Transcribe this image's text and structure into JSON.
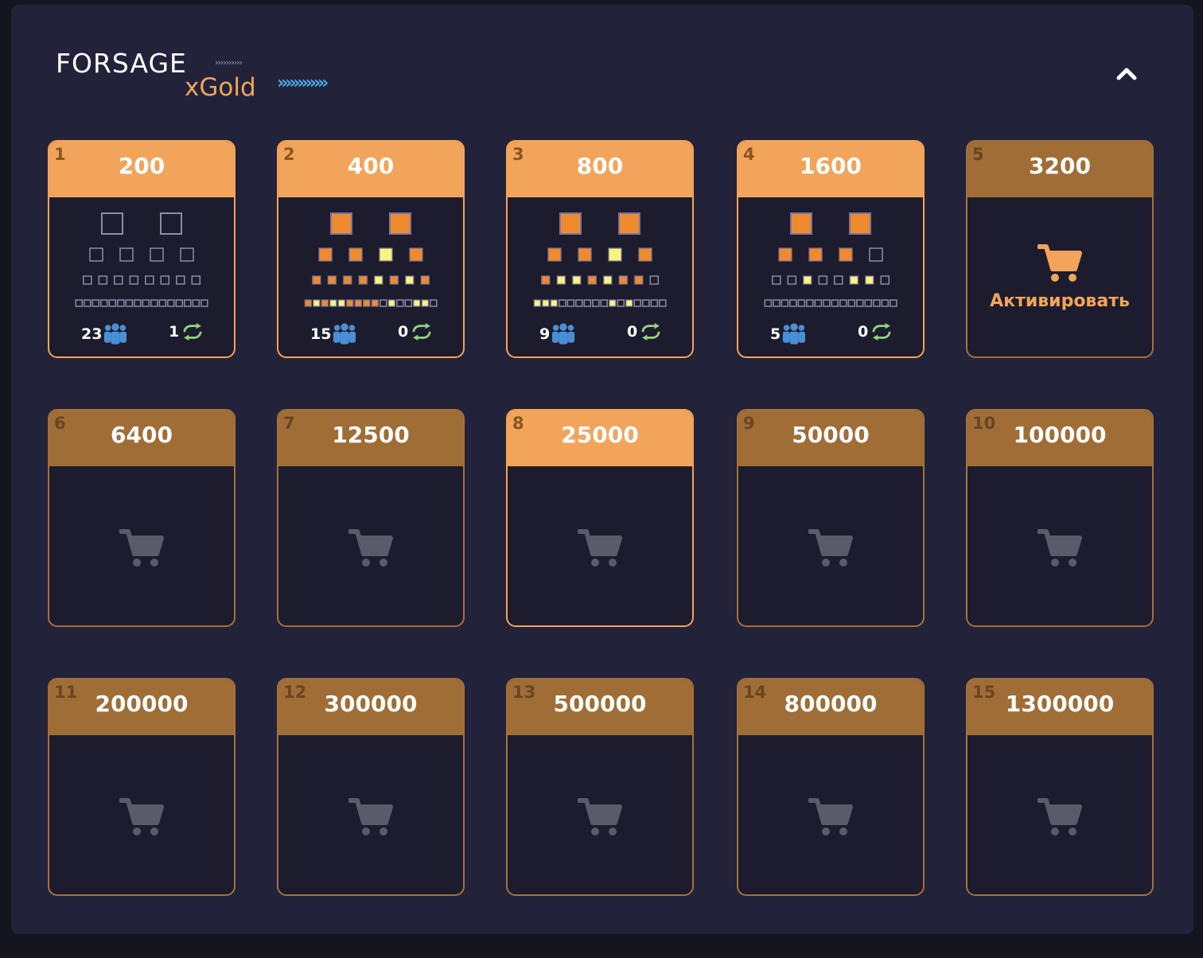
{
  "brand": {
    "name_top": "FORSAGE",
    "chevrons_small": "››››››››››",
    "name_bottom": "xGold",
    "chevrons_big": "»»»»»»"
  },
  "colors": {
    "panel": "#22223a",
    "card_body": "#1d1c2e",
    "active_orange": "#f2a45a",
    "inactive_brown": "#a06d37",
    "filled_square": "#f08a2e",
    "highlight_square": "#f9f57c",
    "empty_square_border": "#8e8aa8",
    "people_blue": "#4a8fd6",
    "recycle_green": "#8fd37e",
    "cart_gray": "#5b5a6b"
  },
  "icons": {
    "collapse": "chevron-up-icon",
    "cart": "cart-icon",
    "people": "people-icon",
    "recycle": "recycle-icon"
  },
  "levels": [
    {
      "num": "1",
      "price": "200",
      "state": "active",
      "rows": [
        "ee",
        "eeee",
        "eeeeeeee",
        "eeeeeeeeeeeeeeee"
      ],
      "partners": "23",
      "reinvests": "1"
    },
    {
      "num": "2",
      "price": "400",
      "state": "active",
      "rows": [
        "ff",
        "ffhf",
        "ffffhfhf",
        "fhfhhffffeheehhe"
      ],
      "partners": "15",
      "reinvests": "0"
    },
    {
      "num": "3",
      "price": "800",
      "state": "active",
      "rows": [
        "ff",
        "ffhf",
        "fhhfhffe",
        "hhheeeeeeheheeee"
      ],
      "partners": "9",
      "reinvests": "0"
    },
    {
      "num": "4",
      "price": "1600",
      "state": "active",
      "rows": [
        "ff",
        "fffe",
        "eeheehhe",
        "eeeeeeeeeeeeeeee"
      ],
      "partners": "5",
      "reinvests": "0"
    },
    {
      "num": "5",
      "price": "3200",
      "state": "buy",
      "action": "Активировать"
    },
    {
      "num": "6",
      "price": "6400",
      "state": "locked"
    },
    {
      "num": "7",
      "price": "12500",
      "state": "locked"
    },
    {
      "num": "8",
      "price": "25000",
      "state": "locked-active"
    },
    {
      "num": "9",
      "price": "50000",
      "state": "locked"
    },
    {
      "num": "10",
      "price": "100000",
      "state": "locked"
    },
    {
      "num": "11",
      "price": "200000",
      "state": "locked"
    },
    {
      "num": "12",
      "price": "300000",
      "state": "locked"
    },
    {
      "num": "13",
      "price": "500000",
      "state": "locked"
    },
    {
      "num": "14",
      "price": "800000",
      "state": "locked"
    },
    {
      "num": "15",
      "price": "1300000",
      "state": "locked"
    }
  ]
}
